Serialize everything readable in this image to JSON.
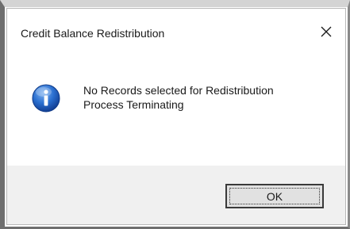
{
  "dialog": {
    "title": "Credit Balance Redistribution",
    "close_glyph": "✕",
    "icon": "info-icon",
    "message_lines": [
      "No Records selected for Redistribution",
      "Process Terminating"
    ],
    "ok_label": "OK"
  },
  "colors": {
    "icon_blue": "#1f63c6",
    "footer_bg": "#f0f0f0",
    "button_bg": "#e1e1e1"
  }
}
